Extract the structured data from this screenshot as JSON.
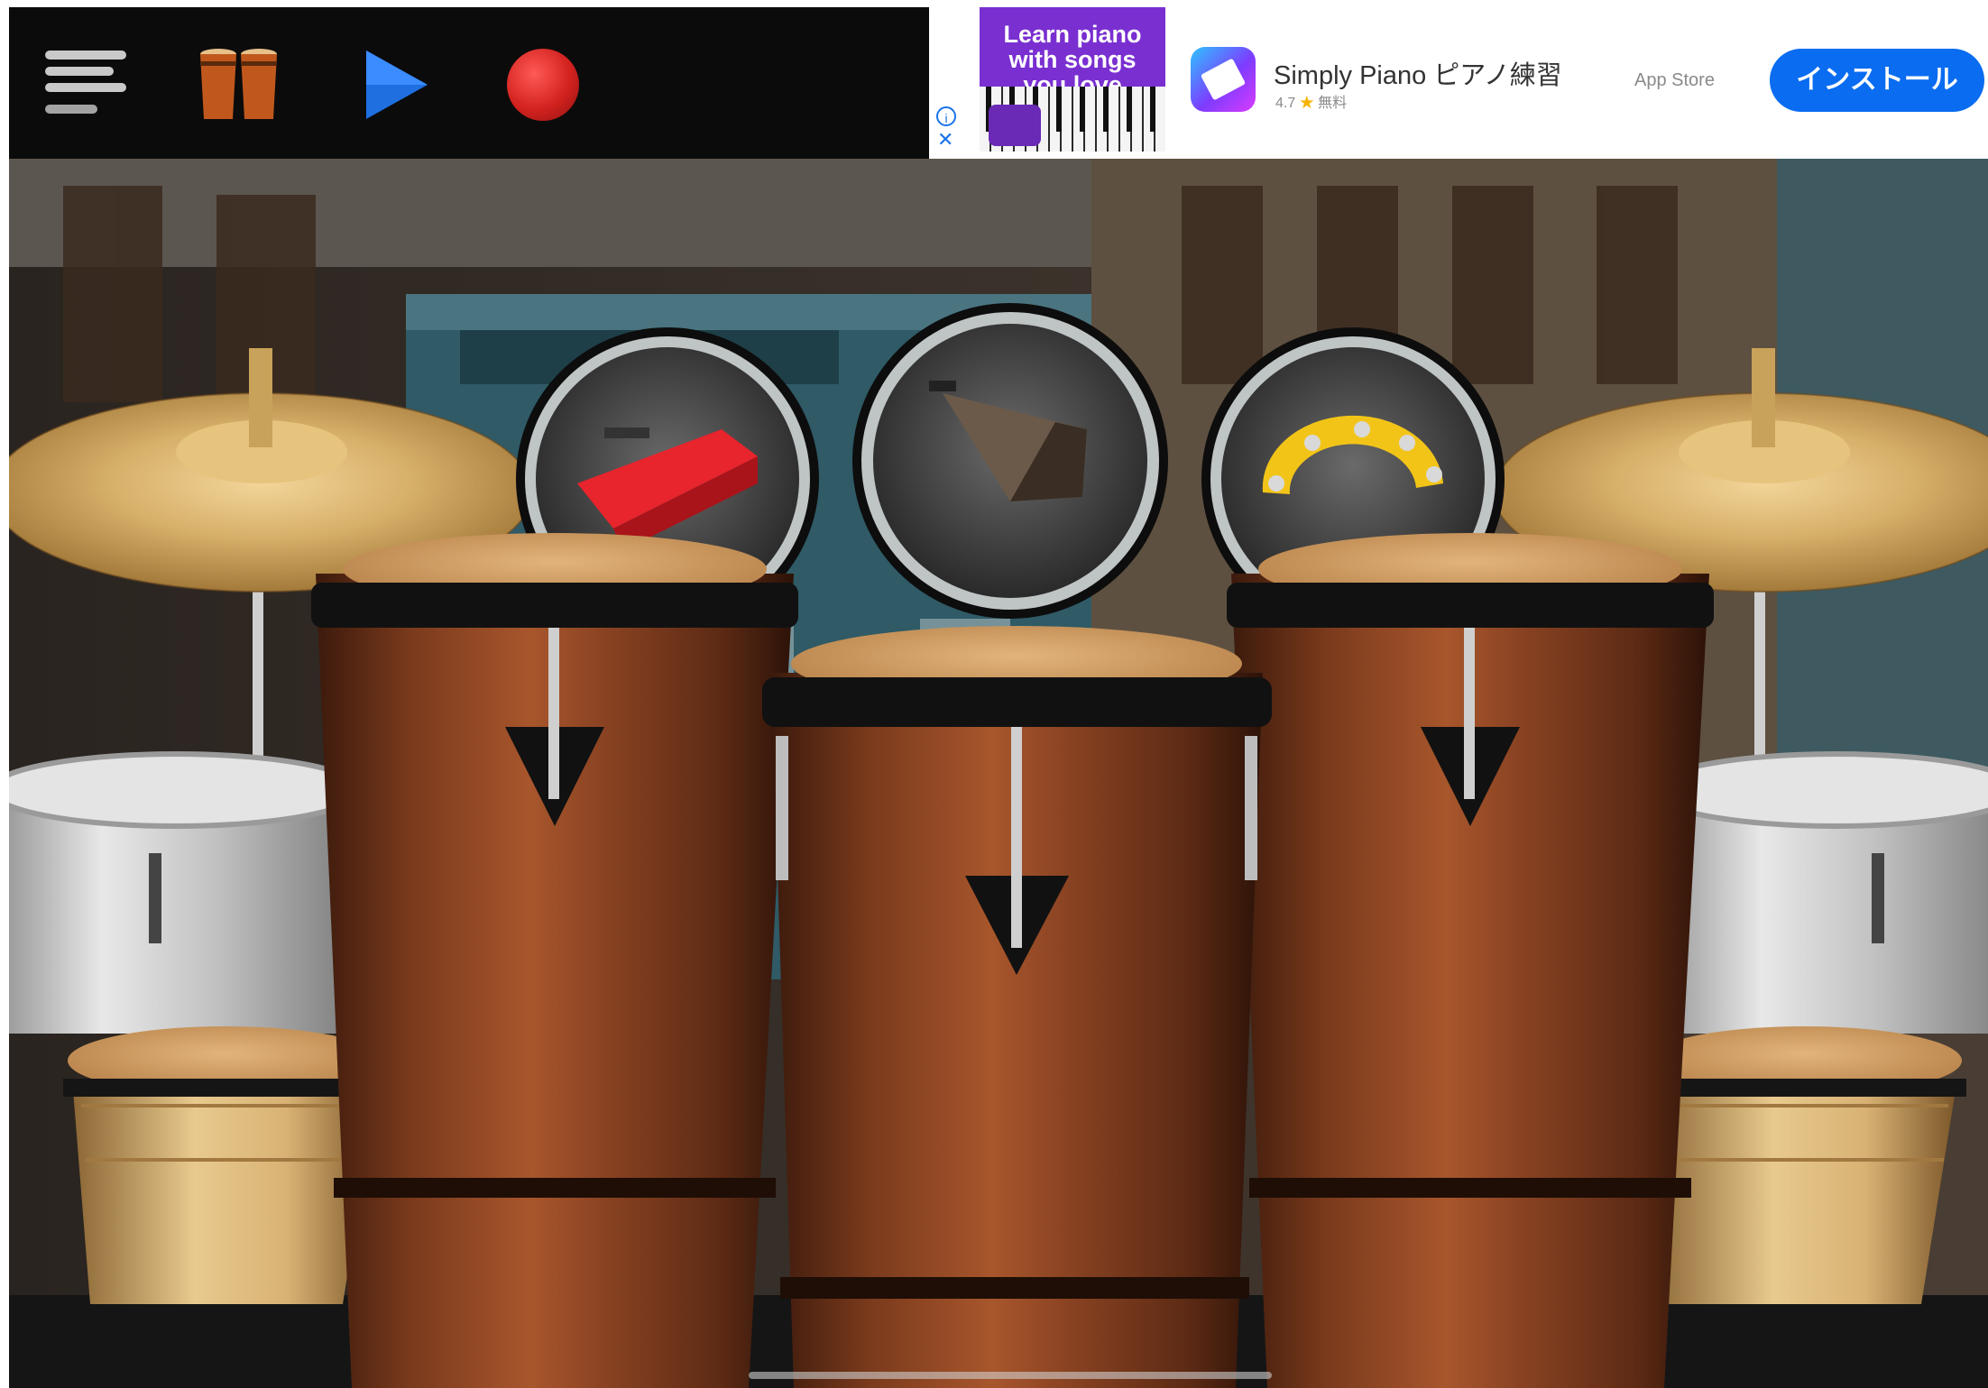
{
  "toolbar": {
    "menu_icon": "hamburger-menu-icon",
    "instrument_icon": "conga-drums-icon",
    "play_icon": "play-triangle-icon",
    "record_icon": "record-circle-icon",
    "play_color": "#1f6fe0",
    "record_color": "#d3221f"
  },
  "ad": {
    "headline": "Learn piano with songs you love",
    "app_name": "Simply Piano ピアノ練習",
    "rating": "4.7",
    "rating_extra": "無料",
    "store": "App Store",
    "install_label": "インストール",
    "install_color": "#0a6cf0"
  },
  "scene": {
    "percussion_pads": [
      {
        "name": "jam-block",
        "color": "#e8242c"
      },
      {
        "name": "cowbell",
        "color": "#6b5a4a"
      },
      {
        "name": "tambourine",
        "color": "#f2c418"
      }
    ],
    "cymbals": [
      "left-cymbal",
      "right-cymbal"
    ],
    "congas": [
      "left-conga",
      "center-conga",
      "right-conga"
    ],
    "timbales": [
      "left-timbale",
      "right-timbale"
    ],
    "bongos": [
      "left-bongo",
      "right-bongo"
    ]
  }
}
